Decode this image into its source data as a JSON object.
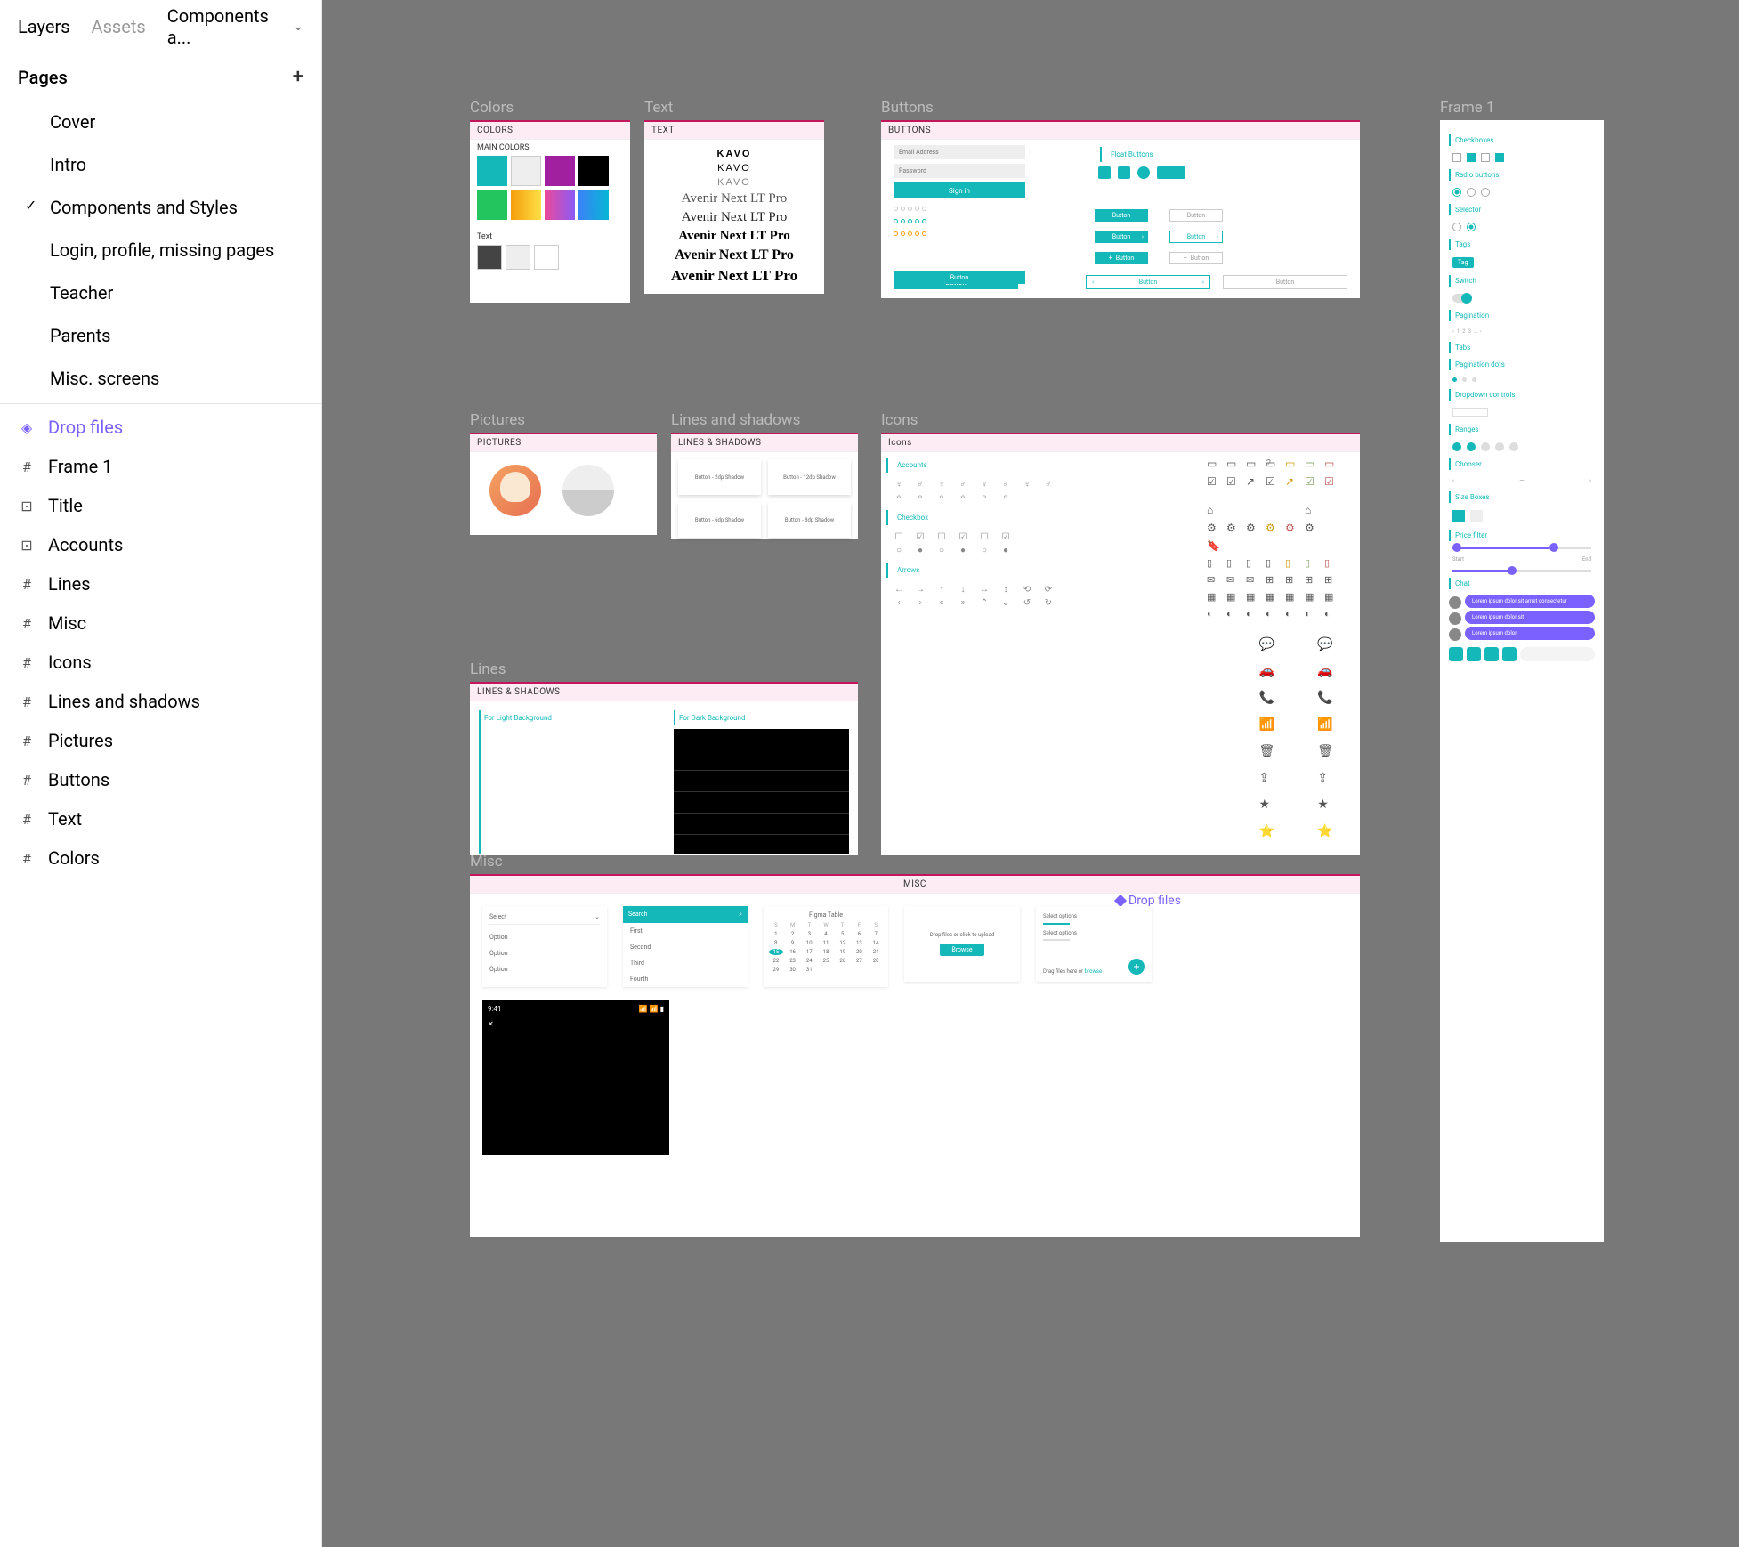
{
  "sidebar": {
    "tabs": {
      "layers": "Layers",
      "assets": "Assets"
    },
    "fileMenu": "Components a...",
    "pagesHeader": "Pages",
    "pages": [
      {
        "label": "Cover",
        "selected": false
      },
      {
        "label": "Intro",
        "selected": false
      },
      {
        "label": "Components and Styles",
        "selected": true
      },
      {
        "label": "Login, profile, missing pages",
        "selected": false
      },
      {
        "label": "Teacher",
        "selected": false
      },
      {
        "label": "Parents",
        "selected": false
      },
      {
        "label": "Misc. screens",
        "selected": false
      }
    ],
    "layers": [
      {
        "icon": "◈",
        "label": "Drop files",
        "selected": true
      },
      {
        "icon": "#",
        "label": "Frame 1"
      },
      {
        "icon": "⊡",
        "label": "Title"
      },
      {
        "icon": "⊡",
        "label": "Accounts"
      },
      {
        "icon": "#",
        "label": "Lines"
      },
      {
        "icon": "#",
        "label": "Misc"
      },
      {
        "icon": "#",
        "label": "Icons"
      },
      {
        "icon": "#",
        "label": "Lines and shadows"
      },
      {
        "icon": "#",
        "label": "Pictures"
      },
      {
        "icon": "#",
        "label": "Buttons"
      },
      {
        "icon": "#",
        "label": "Text"
      },
      {
        "icon": "#",
        "label": "Colors"
      }
    ]
  },
  "frames": {
    "colors": {
      "title": "Colors",
      "header": "COLORS",
      "main": "MAIN COLORS",
      "text": "Text",
      "row1": [
        "#14b8b8",
        "#eeeeee",
        "#a020a0",
        "#000000"
      ],
      "row2": [
        "#22c55e",
        "linear-gradient(90deg,#f59e0b,#fde047)",
        "linear-gradient(90deg,#ec4899,#8b5cf6)",
        "linear-gradient(90deg,#3b82f6,#06b6d4)"
      ],
      "textRow": [
        "#444444",
        "#eeeeee",
        "#ffffff"
      ]
    },
    "text": {
      "title": "Text",
      "header": "TEXT",
      "brand": "KAVO",
      "family": "Avenir Next LT Pro"
    },
    "buttons": {
      "title": "Buttons",
      "header": "BUTTONS",
      "section": "Float Buttons",
      "email": "Email Address",
      "password": "Password",
      "signin": "Sign in",
      "btn": "Button"
    },
    "pictures": {
      "title": "Pictures",
      "header": "PICTURES"
    },
    "ls": {
      "title": "Lines and shadows",
      "header": "LINES & SHADOWS",
      "cards": [
        "Button - 2dp Shadow",
        "Button - 12dp Shadow",
        "Button - 6dp Shadow",
        "Button - 8dp Shadow"
      ]
    },
    "lines": {
      "title": "Lines",
      "header": "LINES & SHADOWS",
      "light": "For Light Background",
      "dark": "For Dark Background"
    },
    "icons": {
      "title": "Icons",
      "header": "Icons",
      "sections": [
        "Accounts",
        "Checkbox",
        "Arrows"
      ]
    },
    "f1": {
      "title": "Frame 1",
      "sections": [
        "Checkboxes",
        "Radio buttons",
        "Selector",
        "Tags",
        "Switch",
        "Pagination",
        "Tabs",
        "Pagination dots",
        "Dropdown controls",
        "Ranges",
        "Chooser",
        "Size Boxes",
        "Price filter",
        "Chat"
      ],
      "tag": "Tag",
      "priceStart": "Start",
      "priceEnd": "End",
      "chat": [
        "Lorem ipsum dolor sit amet consectetur",
        "Lorem ipsum dolor sit",
        "Lorem ipsum dolor"
      ]
    },
    "misc": {
      "title": "Misc",
      "header": "MISC",
      "dropLabel": "Drop files",
      "dd": [
        "Select",
        "Option",
        "Option",
        "Option"
      ],
      "sel": {
        "header": "Search",
        "opts": [
          "First",
          "Second",
          "Third",
          "Fourth"
        ]
      },
      "cal": {
        "title": "Figma Table"
      },
      "drop": {
        "text": "Drop files or click to upload",
        "btn": "Browse"
      },
      "drop2": {
        "text": "Select options",
        "drag": "Drag files here or ",
        "browse": "browse"
      },
      "phone": {
        "time": "9:41",
        "close": "✕"
      }
    }
  }
}
